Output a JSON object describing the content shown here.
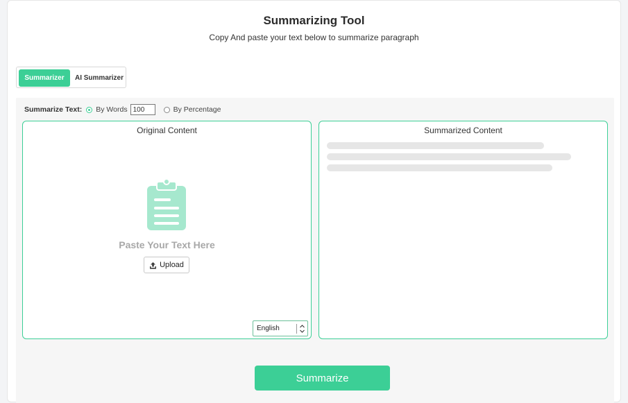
{
  "header": {
    "title": "Summarizing Tool",
    "subtitle": "Copy And paste your text below to summarize paragraph"
  },
  "tabs": [
    {
      "label": "Summarizer",
      "active": true
    },
    {
      "label": "AI Summarizer",
      "active": false
    }
  ],
  "options": {
    "label": "Summarize Text:",
    "by_words_label": "By Words",
    "words_value": "100",
    "by_percentage_label": "By Percentage",
    "selected": "By Words"
  },
  "original": {
    "title": "Original Content",
    "placeholder": "Paste Your Text Here",
    "upload_label": "Upload",
    "language": "English"
  },
  "summarized": {
    "title": "Summarized Content"
  },
  "summarize_button": "Summarize",
  "colors": {
    "accent": "#3ccf96",
    "icon_fill": "#a6e8ce"
  }
}
